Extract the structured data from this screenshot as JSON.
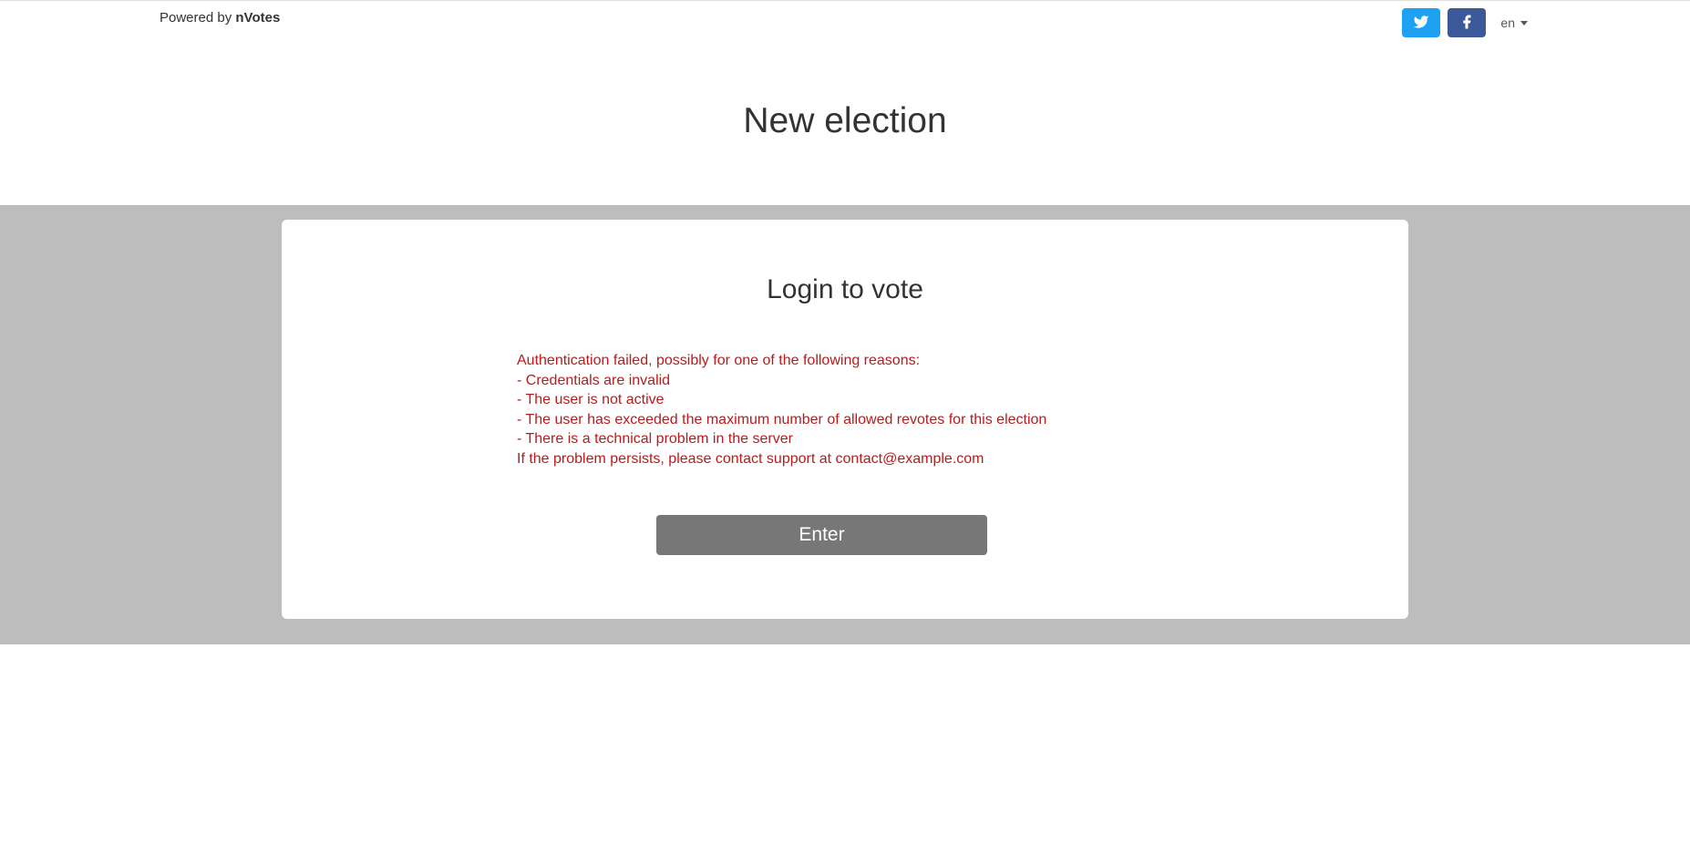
{
  "header": {
    "powered_prefix": "Powered by ",
    "brand": "nVotes",
    "lang": "en"
  },
  "title": "New election",
  "card": {
    "title": "Login to vote",
    "error": {
      "intro": "Authentication failed, possibly for one of the following reasons:",
      "r1": "- Credentials are invalid",
      "r2": "- The user is not active",
      "r3": "- The user has exceeded the maximum number of allowed revotes for this election",
      "r4": "- There is a technical problem in the server",
      "outro": "If the problem persists, please contact support at contact@example.com"
    },
    "enter_label": "Enter"
  }
}
